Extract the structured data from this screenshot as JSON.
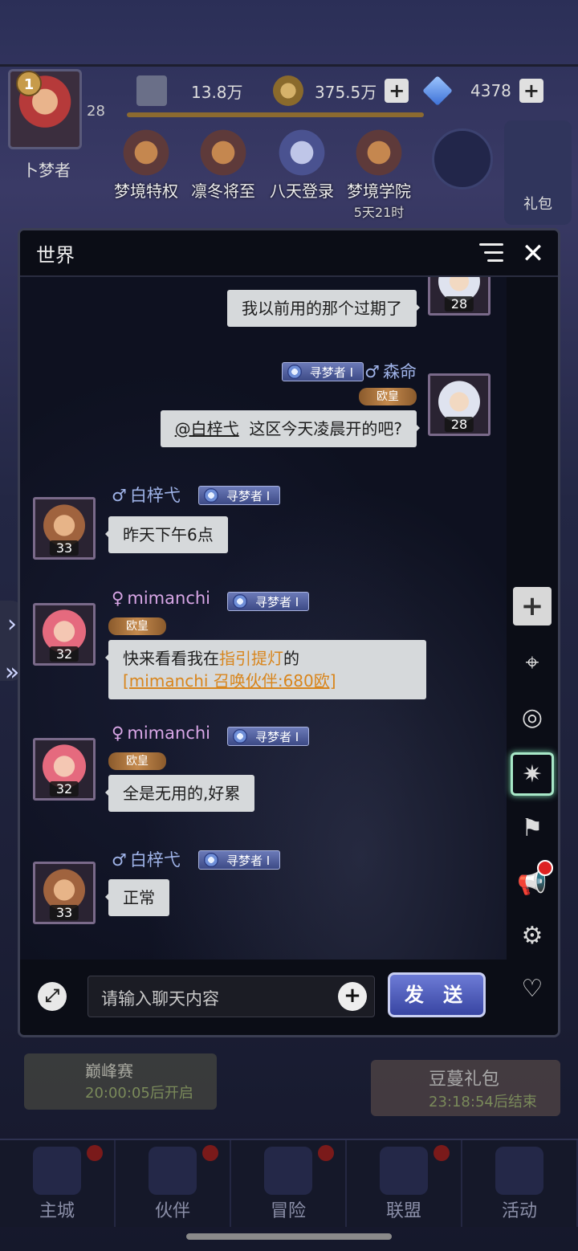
{
  "top": {
    "player_level_badge": "1",
    "user_level": "28",
    "player_name": "卜梦者",
    "power": "13.8万",
    "gold": "375.5万",
    "gems": "4378",
    "quick_links": [
      {
        "label": "梦境特权",
        "sub": ""
      },
      {
        "label": "凛冬将至",
        "sub": ""
      },
      {
        "label": "八天登录",
        "sub": ""
      },
      {
        "label": "梦境学院",
        "sub": "5天21时"
      }
    ],
    "gift_label": "礼包"
  },
  "chat": {
    "title": "世界",
    "messages": [
      {
        "side": "right",
        "text": "我以前用的那个过期了",
        "level": "28"
      },
      {
        "side": "right",
        "name": "森命",
        "gender": "♂",
        "rank": "寻梦者 I",
        "vip": "欧皇",
        "mention": "@白梓弋",
        "text": "这区今天凌晨开的吧?",
        "level": "28"
      },
      {
        "side": "left",
        "name": "白梓弋",
        "gender": "♂",
        "rank": "寻梦者 I",
        "text": "昨天下午6点",
        "level": "33"
      },
      {
        "side": "left",
        "name": "mimanchi",
        "gender": "♀",
        "rank": "寻梦者 I",
        "vip": "欧皇",
        "text_a": "快来看看我在",
        "text_link": "指引提灯",
        "text_b": "的",
        "share": "[mimanchi 召唤伙伴:680欧]",
        "level": "32"
      },
      {
        "side": "left",
        "name": "mimanchi",
        "gender": "♀",
        "rank": "寻梦者 I",
        "vip": "欧皇",
        "text": "全是无用的,好累",
        "level": "32"
      },
      {
        "side": "left",
        "name": "白梓弋",
        "gender": "♂",
        "rank": "寻梦者 I",
        "text": "正常",
        "level": "33"
      }
    ],
    "input_placeholder": "请输入聊天内容",
    "send_label": "发 送"
  },
  "events": {
    "left_title": "巅峰赛",
    "left_time": "20:00:05后开启",
    "right_title": "豆蔓礼包",
    "right_time": "23:18:54后结束"
  },
  "nav": [
    "主城",
    "伙伴",
    "冒险",
    "联盟",
    "活动"
  ],
  "icons": {
    "side": [
      "plus-icon",
      "location-icon",
      "planet-icon",
      "compass-icon",
      "banner-icon",
      "megaphone-icon",
      "gear-icon",
      "heart-chat-icon"
    ]
  }
}
